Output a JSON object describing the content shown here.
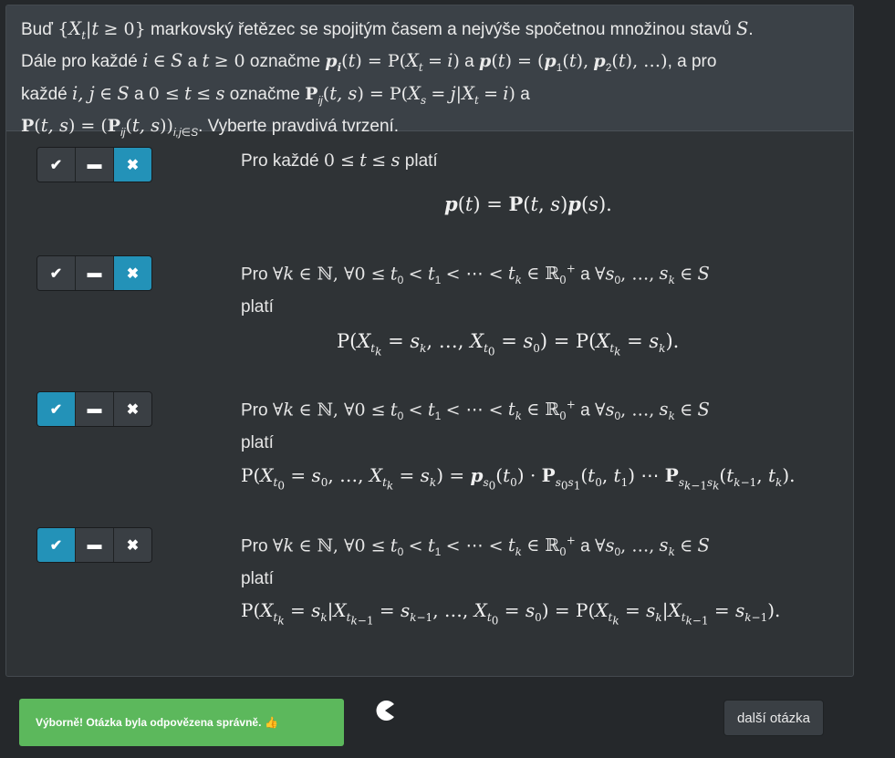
{
  "question": {
    "text_lines": [
      "Buď {Xₜ|t ≥ 0} markovský řetězec se spojitým časem a nejvýše spočetnou množinou stavů S.",
      "Dále pro každé i ∈ S a t ≥ 0 označme pᵢ(t) = P(Xₜ = i) a p(t) = (p₁(t), p₂(t), …), a pro",
      "každé i, j ∈ S a 0 ≤ t ≤ s označme Pᵢⱼ(t, s) = P(Xₛ = j|Xₜ = i) a",
      "P(t, s) = (Pᵢⱼ(t, s))ᵢ,ⱼ∈S. Vyberte pravdivá tvrzení."
    ]
  },
  "choice_icons": {
    "yes": "check-icon",
    "neutral": "minus-icon",
    "no": "cross-icon"
  },
  "items": [
    {
      "statement_lines": [
        "Pro každé 0 ≤ t ≤ s platí"
      ],
      "formula": "p(t) = P(t, s)p(s).",
      "selected": "no"
    },
    {
      "statement_lines": [
        "Pro ∀k ∈ ℕ, ∀0 ≤ t₀ < t₁ < ⋯ < tₖ ∈ ℝ₀⁺ a ∀s₀, …, sₖ ∈ S",
        "platí"
      ],
      "formula": "P(Xₜₖ = sₖ, …, Xₜ₀ = s₀) = P(Xₜₖ = sₖ).",
      "selected": "no"
    },
    {
      "statement_lines": [
        "Pro ∀k ∈ ℕ, ∀0 ≤ t₀ < t₁ < ⋯ < tₖ ∈ ℝ₀⁺ a ∀s₀, …, sₖ ∈ S",
        "platí"
      ],
      "formula": "P(Xₜ₀ = s₀, …, Xₜₖ = sₖ) = pₛ₀(t₀) · Pₛ₀ₛ₁(t₀, t₁) ⋯ Pₛₖ₋₁ₛₖ(tₖ₋₁, tₖ).",
      "selected": "yes"
    },
    {
      "statement_lines": [
        "Pro ∀k ∈ ℕ, ∀0 ≤ t₀ < t₁ < ⋯ < tₖ ∈ ℝ₀⁺ a ∀s₀, …, sₖ ∈ S",
        "platí"
      ],
      "formula": "P(Xₜₖ = sₖ|Xₜₖ₋₁ = sₖ₋₁, …, Xₜ₀ = s₀) = P(Xₜₖ = sₖ|Xₜₖ₋₁ = sₖ₋₁).",
      "selected": "yes"
    }
  ],
  "feedback": {
    "message": "Výborně! Otázka byla odpovězena správně.",
    "icon": "thumbs-up-icon",
    "color": "#5cb85c"
  },
  "next_button": {
    "label": "další otázka"
  },
  "accent_color": "#2392b8"
}
